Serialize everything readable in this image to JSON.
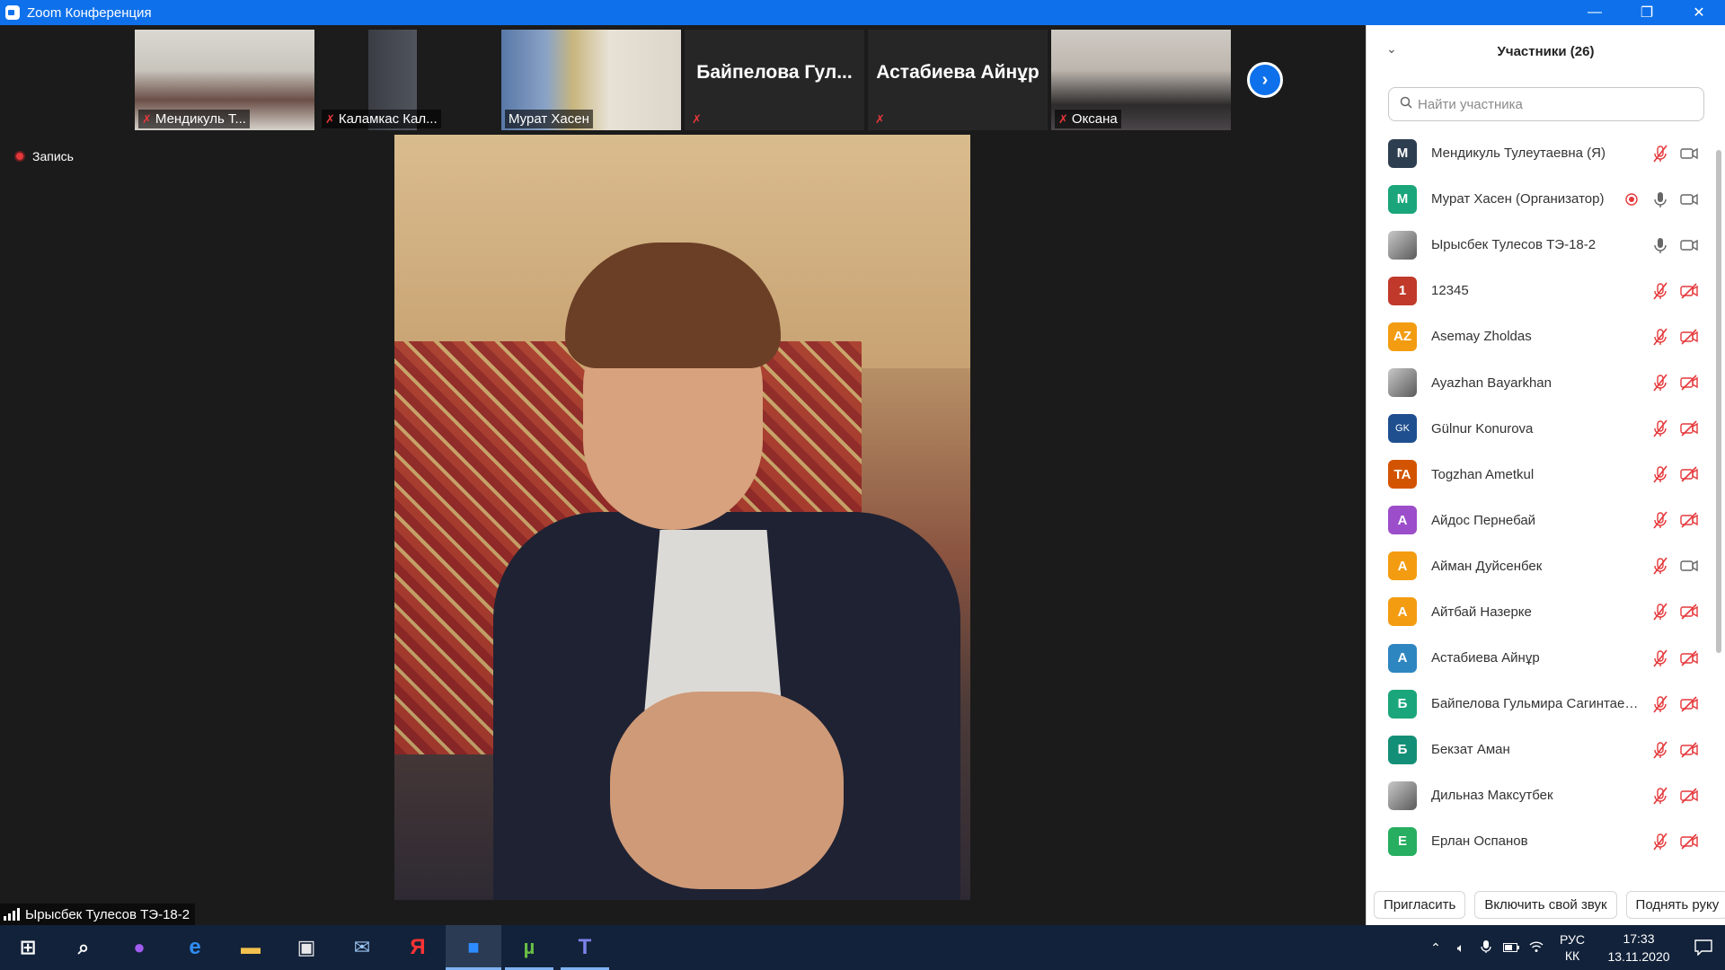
{
  "window": {
    "title": "Zoom Конференция",
    "controls": {
      "minimize": "—",
      "restore": "❐",
      "close": "✕"
    }
  },
  "thumbnails": [
    {
      "name": "Мендикуль Т...",
      "type": "video"
    },
    {
      "name": "Каламкас Кал...",
      "type": "video"
    },
    {
      "name": "Мурат Хасен",
      "type": "video"
    },
    {
      "name": "Байпелова  Гул...",
      "type": "name-only"
    },
    {
      "name": "Астабиева Айнұр",
      "type": "name-only"
    },
    {
      "name": "Оксана",
      "type": "video"
    }
  ],
  "thumb_next_glyph": "›",
  "recording": {
    "label": "Запись"
  },
  "active_speaker": {
    "name": "Ырысбек Тулесов ТЭ-18-2"
  },
  "participants_panel": {
    "title": "Участники (26)",
    "collapse_glyph": "⌄",
    "search_placeholder": "Найти участника",
    "participants": [
      {
        "name": "Мендикуль Тулеутаевна (Я)",
        "initial": "M",
        "color": "#2d3e50",
        "mic": "muted",
        "cam": "on",
        "rec": false
      },
      {
        "name": "Мурат Хасен (Организатор)",
        "initial": "M",
        "color": "#1aa67a",
        "mic": "on",
        "cam": "on",
        "rec": true
      },
      {
        "name": "Ырысбек Тулесов ТЭ-18-2",
        "initial": "",
        "color": "#7a7a7a",
        "mic": "on",
        "cam": "on",
        "rec": false,
        "photo": true
      },
      {
        "name": "12345",
        "initial": "1",
        "color": "#c0392b",
        "mic": "muted",
        "cam": "off",
        "rec": false
      },
      {
        "name": "Asemay Zholdas",
        "initial": "AZ",
        "color": "#f39c12",
        "mic": "muted",
        "cam": "off",
        "rec": false
      },
      {
        "name": "Ayazhan Bayarkhan",
        "initial": "",
        "color": "#9a9a9a",
        "mic": "muted",
        "cam": "off",
        "rec": false,
        "photo": true
      },
      {
        "name": "Gülnur Konurova",
        "initial": "GK",
        "color": "#1f4f8f",
        "mic": "muted",
        "cam": "off",
        "rec": false,
        "small": true
      },
      {
        "name": "Togzhan Ametkul",
        "initial": "TA",
        "color": "#d35400",
        "mic": "muted",
        "cam": "off",
        "rec": false
      },
      {
        "name": "Айдос Пернебай",
        "initial": "А",
        "color": "#9b4dca",
        "mic": "muted",
        "cam": "off",
        "rec": false
      },
      {
        "name": "Айман Дуйсенбек",
        "initial": "А",
        "color": "#f39c12",
        "mic": "muted",
        "cam": "on",
        "rec": false
      },
      {
        "name": "Айтбай Назерке",
        "initial": "А",
        "color": "#f39c12",
        "mic": "muted",
        "cam": "off",
        "rec": false
      },
      {
        "name": "Астабиева Айнұр",
        "initial": "А",
        "color": "#2e86c1",
        "mic": "muted",
        "cam": "off",
        "rec": false
      },
      {
        "name": "Байпелова Гульмира Сагинтаевна",
        "initial": "Б",
        "color": "#1aa67a",
        "mic": "muted",
        "cam": "off",
        "rec": false
      },
      {
        "name": "Бекзат Аман",
        "initial": "Б",
        "color": "#148f77",
        "mic": "muted",
        "cam": "off",
        "rec": false
      },
      {
        "name": "Дильназ Максутбек",
        "initial": "",
        "color": "#8a8a8a",
        "mic": "muted",
        "cam": "off",
        "rec": false,
        "photo": true
      },
      {
        "name": "Ерлан Оспанов",
        "initial": "Е",
        "color": "#27ae60",
        "mic": "muted",
        "cam": "off",
        "rec": false
      }
    ],
    "footer": {
      "invite": "Пригласить",
      "unmute": "Включить свой звук",
      "raise_hand": "Поднять руку"
    }
  },
  "taskbar": {
    "items": [
      {
        "name": "start",
        "glyph": "⊞",
        "color": "#ffffff"
      },
      {
        "name": "search",
        "glyph": "⌕",
        "color": "#ffffff"
      },
      {
        "name": "alice",
        "glyph": "●",
        "color": "#a05cf0"
      },
      {
        "name": "edge",
        "glyph": "e",
        "color": "#2f8df2"
      },
      {
        "name": "explorer",
        "glyph": "▬",
        "color": "#f2c14e"
      },
      {
        "name": "store",
        "glyph": "▣",
        "color": "#e8e8e8"
      },
      {
        "name": "mail",
        "glyph": "✉",
        "color": "#9dc5f2"
      },
      {
        "name": "yandex",
        "glyph": "Я",
        "color": "#ff3333"
      },
      {
        "name": "zoom",
        "glyph": "■",
        "color": "#2d8cff"
      },
      {
        "name": "utorrent",
        "glyph": "µ",
        "color": "#6ac045"
      },
      {
        "name": "teams",
        "glyph": "T",
        "color": "#7b83eb"
      }
    ],
    "tray": {
      "lang_top": "РУС",
      "lang_bottom": "КК",
      "time": "17:33",
      "date": "13.11.2020"
    }
  }
}
